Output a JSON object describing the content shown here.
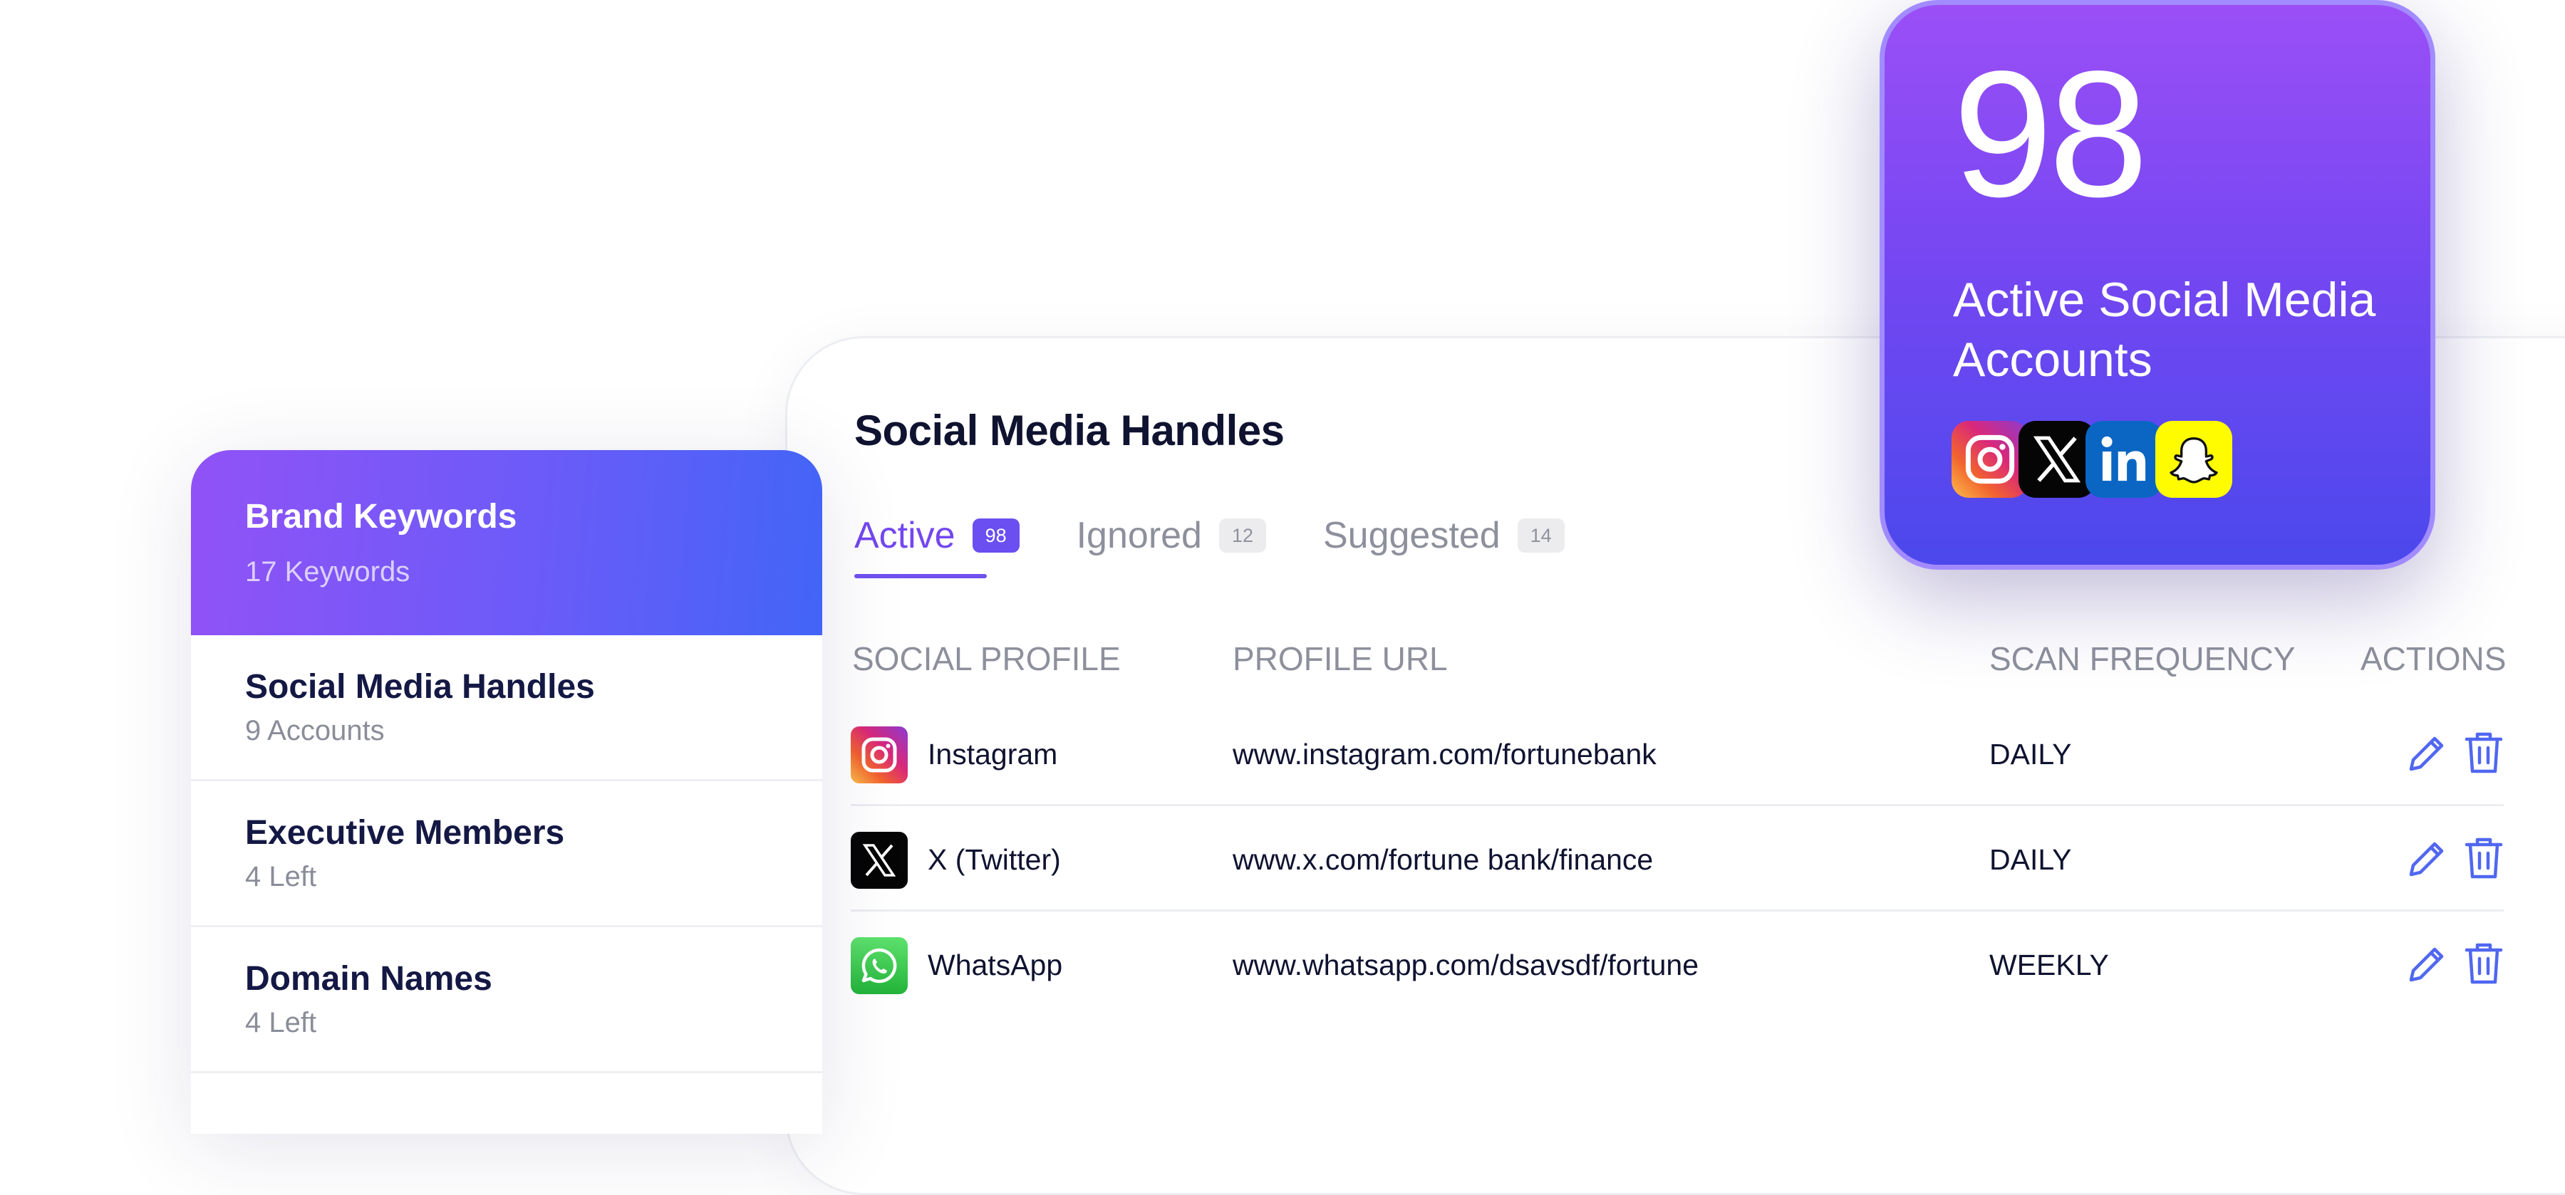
{
  "sidebar": {
    "header": {
      "title": "Brand Keywords",
      "subtitle": "17 Keywords"
    },
    "items": [
      {
        "title": "Social Media Handles",
        "subtitle": "9 Accounts"
      },
      {
        "title": "Executive Members",
        "subtitle": "4 Left"
      },
      {
        "title": "Domain Names",
        "subtitle": "4 Left"
      }
    ]
  },
  "panel": {
    "title": "Social Media Handles",
    "tabs": [
      {
        "label": "Active",
        "count": "98"
      },
      {
        "label": "Ignored",
        "count": "12"
      },
      {
        "label": "Suggested",
        "count": "14"
      }
    ],
    "columns": {
      "profile": "SOCIAL PROFILE",
      "url": "PROFILE URL",
      "frequency": "SCAN FREQUENCY",
      "actions": "ACTIONS"
    },
    "rows": [
      {
        "icon": "instagram-logo-icon",
        "name": "Instagram",
        "url": "www.instagram.com/fortunebank",
        "frequency": "DAILY"
      },
      {
        "icon": "x-logo-icon",
        "name": "X (Twitter)",
        "url": "www.x.com/fortune bank/finance",
        "frequency": "DAILY"
      },
      {
        "icon": "whatsapp-logo-icon",
        "name": "WhatsApp",
        "url": "www.whatsapp.com/dsavsdf/fortune",
        "frequency": "WEEKLY"
      }
    ],
    "row_actions": [
      "pencil-icon",
      "trash-icon"
    ]
  },
  "stat_card": {
    "number": "98",
    "label": "Active Social Media Accounts",
    "logos": [
      "instagram-logo-icon",
      "x-logo-icon",
      "linkedin-logo-icon",
      "snapchat-logo-icon"
    ]
  },
  "colors": {
    "accent": "#7150f1",
    "action_blue": "#5067f0",
    "text_dark": "#0f1330",
    "text_muted": "#8d909c",
    "card_gradient_start": "#9b4ff6",
    "card_gradient_end": "#4b48ec"
  }
}
